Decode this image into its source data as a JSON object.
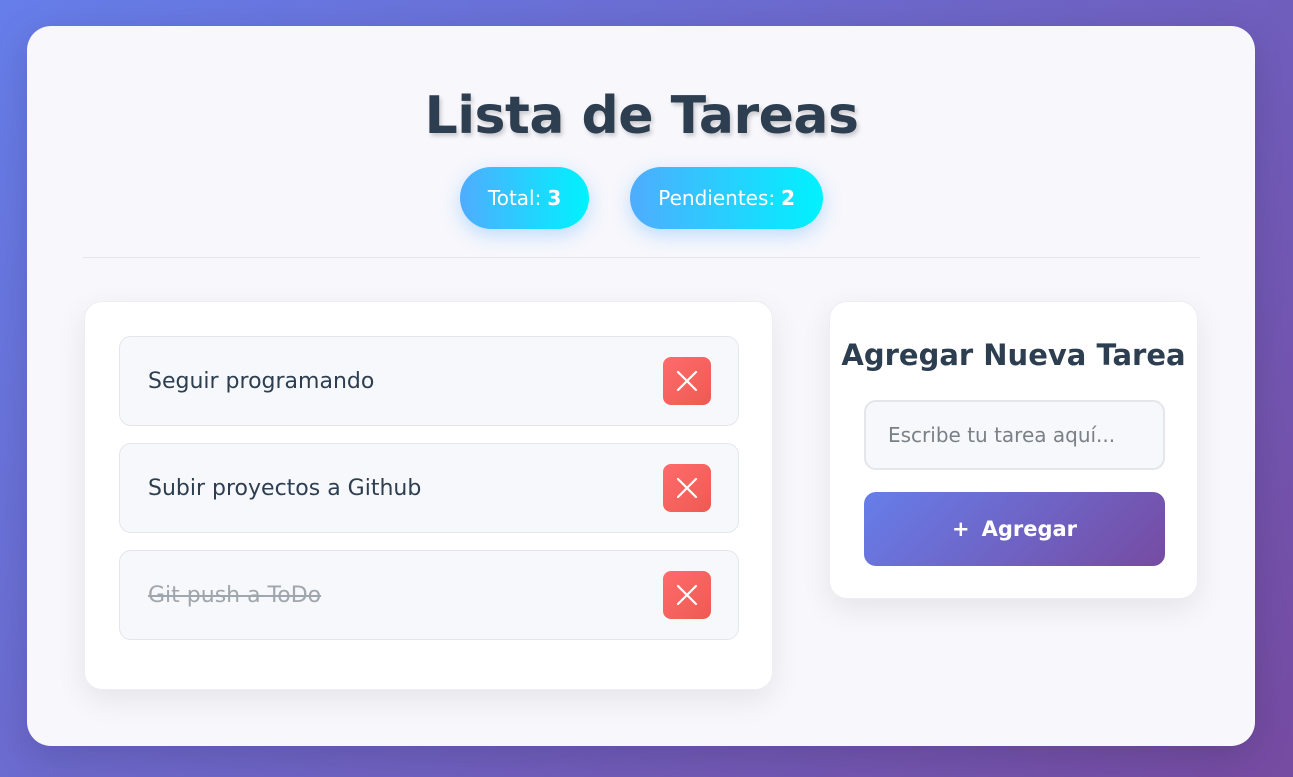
{
  "header": {
    "title": "Lista de Tareas",
    "stats": {
      "total_label": "Total:",
      "total_value": "3",
      "pending_label": "Pendientes:",
      "pending_value": "2"
    }
  },
  "tasks": [
    {
      "text": "Seguir programando",
      "completed": false,
      "delete_icon": "close-icon"
    },
    {
      "text": "Subir proyectos a Github",
      "completed": false,
      "delete_icon": "close-icon"
    },
    {
      "text": "Git push a ToDo",
      "completed": true,
      "delete_icon": "close-icon"
    }
  ],
  "add_form": {
    "title": "Agregar Nueva Tarea",
    "input_placeholder": "Escribe tu tarea aquí...",
    "input_value": "",
    "button_icon": "+",
    "button_label": "Agregar"
  },
  "colors": {
    "background_start": "#667eea",
    "background_end": "#764ba2",
    "badge_start": "#4facfe",
    "badge_end": "#00f2fe",
    "delete_button": "#ff6b6b",
    "title_text": "#2c3e50"
  }
}
